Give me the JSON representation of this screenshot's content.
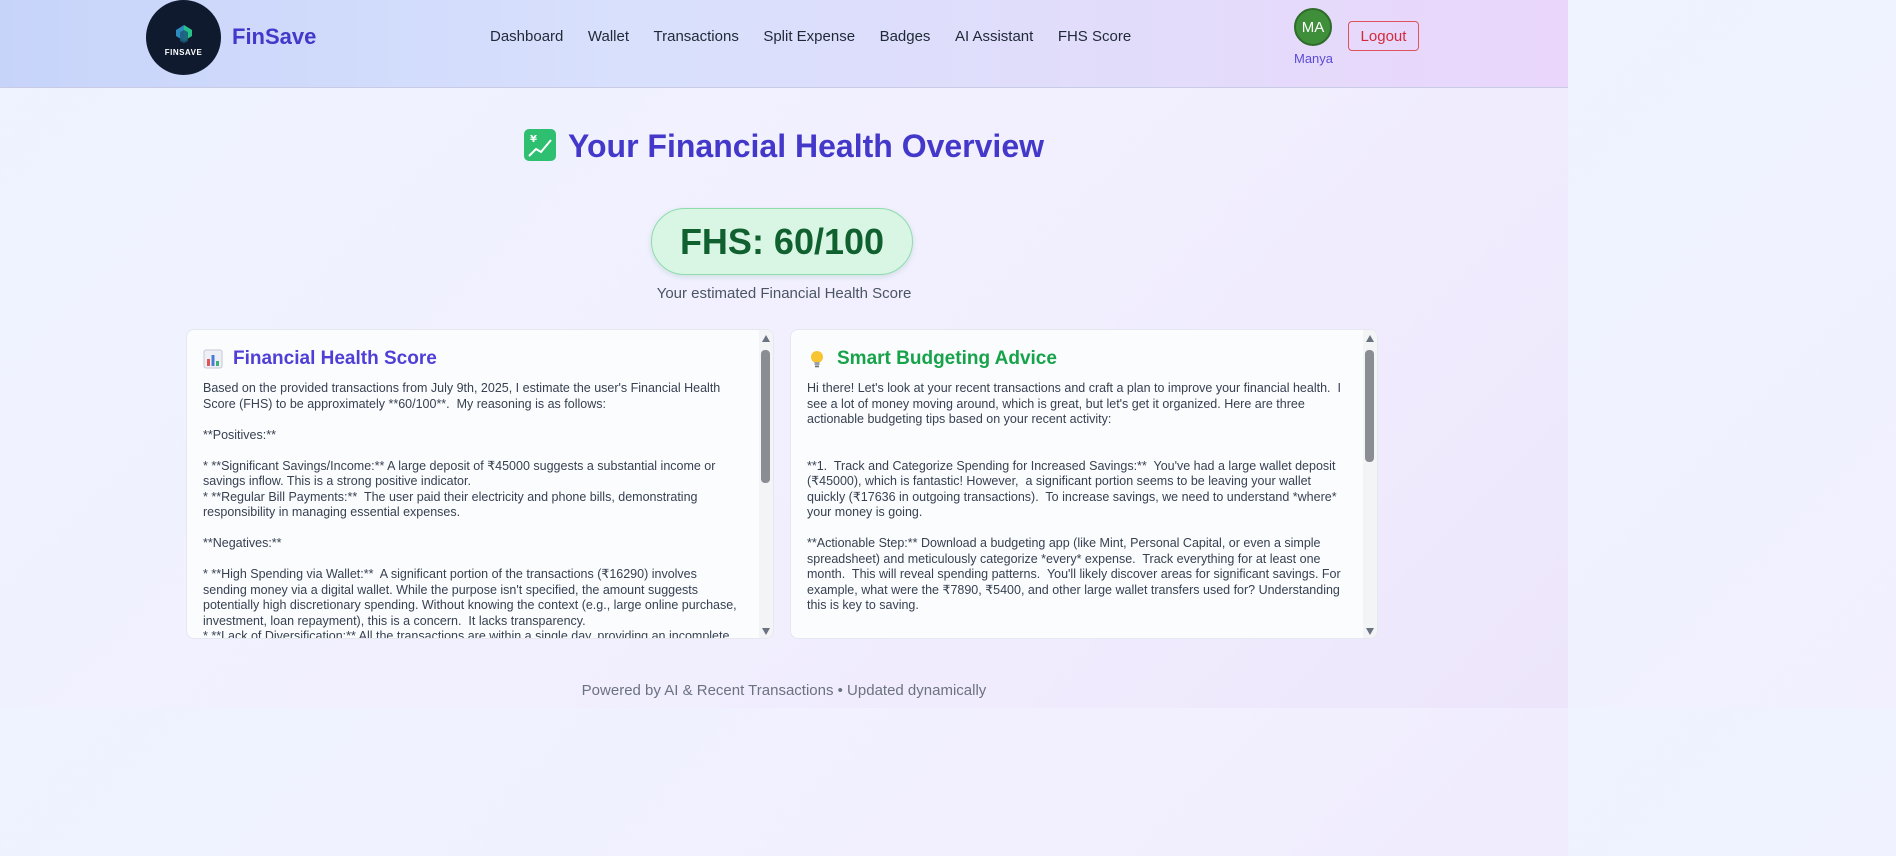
{
  "header": {
    "logo_text": "FINSAVE",
    "brand": "FinSave",
    "nav": [
      "Dashboard",
      "Wallet",
      "Transactions",
      "Split Expense",
      "Badges",
      "AI Assistant",
      "FHS Score"
    ],
    "avatar_initials": "MA",
    "user_name": "Manya",
    "logout_label": "Logout"
  },
  "main": {
    "title": "Your Financial Health Overview",
    "score_label": "FHS: 60/100",
    "score_caption": "Your estimated Financial Health Score"
  },
  "cards": {
    "health": {
      "title": "Financial Health Score",
      "body": "Based on the provided transactions from July 9th, 2025, I estimate the user's Financial Health Score (FHS) to be approximately **60/100**.  My reasoning is as follows:\n\n**Positives:**\n\n* **Significant Savings/Income:** A large deposit of ₹45000 suggests a substantial income or savings inflow. This is a strong positive indicator.\n* **Regular Bill Payments:**  The user paid their electricity and phone bills, demonstrating responsibility in managing essential expenses.\n\n**Negatives:**\n\n* **High Spending via Wallet:**  A significant portion of the transactions (₹16290) involves sending money via a digital wallet. While the purpose isn't specified, the amount suggests potentially high discretionary spending. Without knowing the context (e.g., large online purchase, investment, loan repayment), this is a concern.  It lacks transparency.\n* **Lack of Diversification:** All the transactions are within a single day, providing an incomplete"
    },
    "advice": {
      "title": "Smart Budgeting Advice",
      "body": "Hi there! Let's look at your recent transactions and craft a plan to improve your financial health.  I see a lot of money moving around, which is great, but let's get it organized. Here are three actionable budgeting tips based on your recent activity:\n\n\n**1.  Track and Categorize Spending for Increased Savings:**  You've had a large wallet deposit (₹45000), which is fantastic! However,  a significant portion seems to be leaving your wallet quickly (₹17636 in outgoing transactions).  To increase savings, we need to understand *where* your money is going.\n\n**Actionable Step:** Download a budgeting app (like Mint, Personal Capital, or even a simple spreadsheet) and meticulously categorize *every* expense.  Track everything for at least one month.  This will reveal spending patterns.  You'll likely discover areas for significant savings. For example, what were the ₹7890, ₹5400, and other large wallet transfers used for? Understanding this is key to saving."
    }
  },
  "footer": {
    "text": "Powered by AI & Recent Transactions • Updated dynamically"
  },
  "colors": {
    "brand": "#4338ca",
    "score_bg": "#d8f6e3",
    "score_text": "#11602f",
    "advice_title": "#16a34a",
    "logout": "#d5283a"
  }
}
